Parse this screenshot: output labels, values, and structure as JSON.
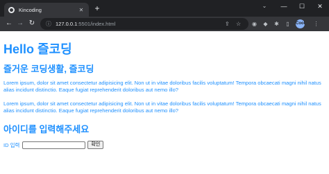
{
  "browser": {
    "tab_title": "Kincoding",
    "tab_close": "✕",
    "new_tab": "+",
    "url_host": "127.0.0.1",
    "url_port": ":5501",
    "url_path": "/index.html",
    "profile_initials": "Cool",
    "window_controls": {
      "chevron": "⌄",
      "minimize": "—",
      "maximize": "☐",
      "close": "✕"
    },
    "nav": {
      "back": "←",
      "forward": "→",
      "reload": "↻"
    }
  },
  "page": {
    "title": "Hello 즐코딩",
    "subtitle": "즐거운 코딩생활, 즐코딩",
    "paragraph1": "Lorem ipsum, dolor sit amet consectetur adipisicing elit. Non ut in vitae doloribus facilis voluptatum! Tempora obcaecati magni nihil natus alias incidunt distinctio. Eaque fugiat reprehenderit doloribus aut nemo illo?",
    "paragraph2": "Lorem ipsum, dolor sit amet consectetur adipisicing elit. Non ut in vitae doloribus facilis voluptatum! Tempora obcaecati magni nihil natus alias incidunt distinctio. Eaque fugiat reprehenderit doloribus aut nemo illo?",
    "id_heading": "아이디를 입력해주세요",
    "id_label": "ID 입력",
    "id_value": "",
    "confirm_label": "확인"
  },
  "colors": {
    "text": "#1e90ff",
    "chrome_dark": "#202124",
    "chrome_toolbar": "#35363a"
  }
}
